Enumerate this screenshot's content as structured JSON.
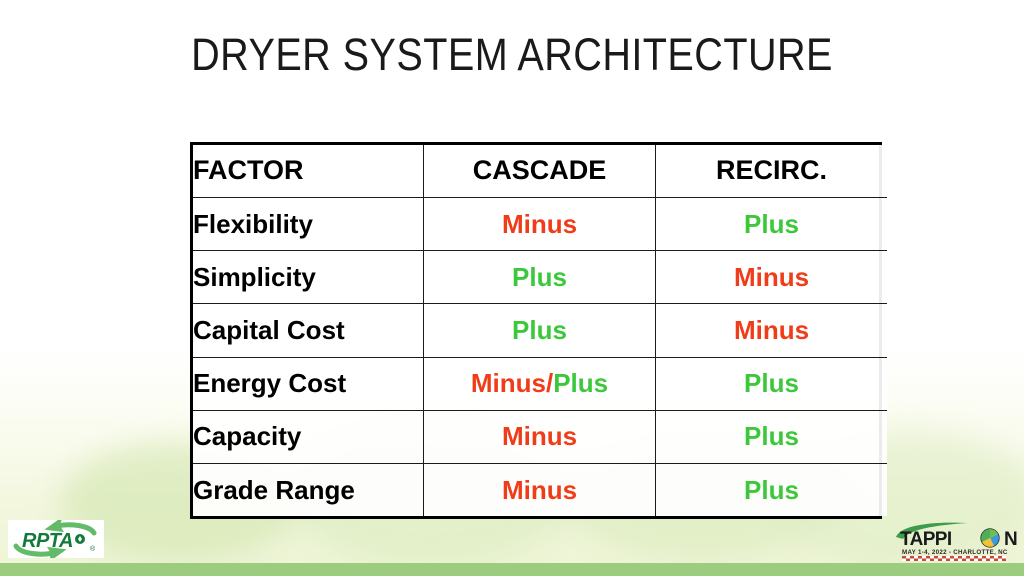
{
  "slide": {
    "title": "DRYER SYSTEM ARCHITECTURE"
  },
  "table": {
    "headers": [
      "FACTOR",
      "CASCADE",
      "RECIRC."
    ],
    "rows": [
      {
        "factor": "Flexibility",
        "cascade": "Minus",
        "recirc": "Plus"
      },
      {
        "factor": "Simplicity",
        "cascade": "Plus",
        "recirc": "Minus"
      },
      {
        "factor": "Capital Cost",
        "cascade": "Plus",
        "recirc": "Minus"
      },
      {
        "factor": "Energy Cost",
        "cascade": "Minus/Plus",
        "recirc": "Plus"
      },
      {
        "factor": "Capacity",
        "cascade": "Minus",
        "recirc": "Plus"
      },
      {
        "factor": "Grade Range",
        "cascade": "Minus",
        "recirc": "Plus"
      }
    ],
    "energy_cost_parts": {
      "first": "Minus",
      "separator": "/",
      "second": "Plus"
    }
  },
  "colors": {
    "minus": "#f03c18",
    "plus": "#3dc83c",
    "bottom_bar": "#9ccc7e",
    "rpta_green_dark": "#147a3b",
    "rpta_green_light": "#62bb68",
    "tappi_black": "#1a1a1a",
    "tappi_green": "#3f9c4a"
  },
  "logos": {
    "rpta": {
      "wordmark": "RPTA",
      "trademark": "®"
    },
    "tappicon": {
      "wordmark_left": "TAPPI",
      "wordmark_globe": "O",
      "wordmark_right": "N",
      "subtitle": "MAY 1-4, 2022 - CHARLOTTE, NC"
    }
  }
}
